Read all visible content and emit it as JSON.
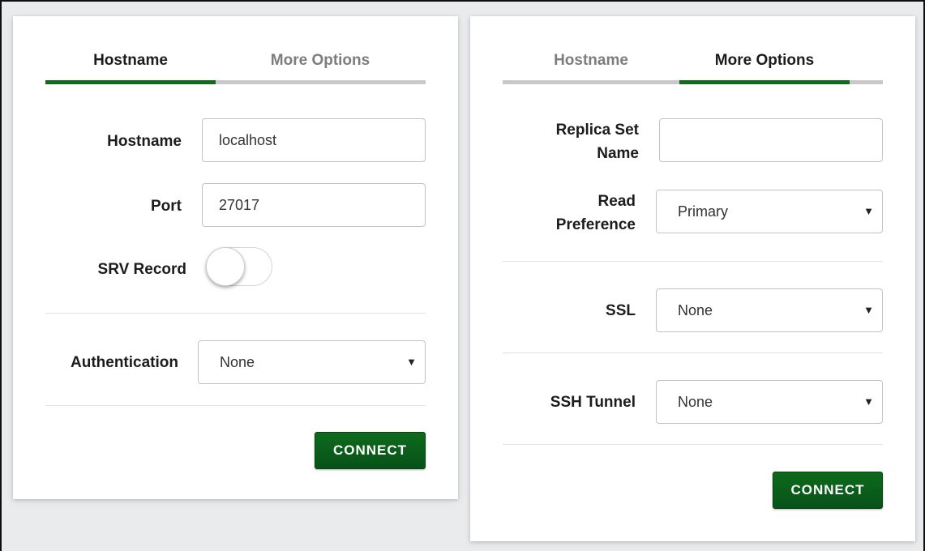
{
  "colors": {
    "accent": "#116b1a",
    "button": "#0a5d1a",
    "inactive_tab": "#7d7d7d",
    "background": "#e9ebed"
  },
  "left_panel": {
    "tabs": [
      {
        "label": "Hostname",
        "active": true
      },
      {
        "label": "More Options",
        "active": false
      }
    ],
    "hostname": {
      "label": "Hostname",
      "value": "localhost"
    },
    "port": {
      "label": "Port",
      "value": "27017"
    },
    "srv_record": {
      "label": "SRV Record",
      "enabled": false
    },
    "authentication": {
      "label": "Authentication",
      "selected": "None"
    },
    "connect_label": "CONNECT"
  },
  "right_panel": {
    "tabs": [
      {
        "label": "Hostname",
        "active": false
      },
      {
        "label": "More Options",
        "active": true
      }
    ],
    "replica_set": {
      "label_line1": "Replica Set",
      "label_line2": "Name",
      "value": ""
    },
    "read_preference": {
      "label_line1": "Read",
      "label_line2": "Preference",
      "selected": "Primary"
    },
    "ssl": {
      "label": "SSL",
      "selected": "None"
    },
    "ssh_tunnel": {
      "label": "SSH Tunnel",
      "selected": "None"
    },
    "connect_label": "CONNECT"
  },
  "icons": {
    "dropdown_caret": "▼"
  }
}
